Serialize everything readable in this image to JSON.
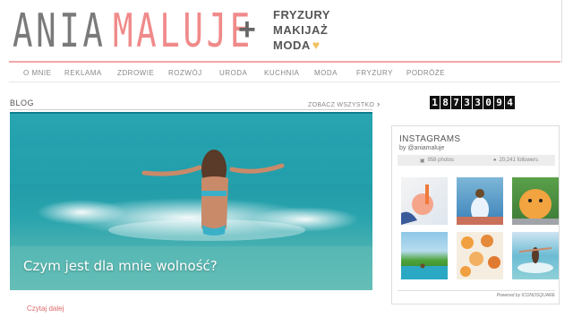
{
  "header": {
    "logo_part1": "ANIA",
    "logo_part2": "MALUJE",
    "plus": "+",
    "tagline": [
      "FRYZURY",
      "MAKIJAŻ",
      "MODA"
    ]
  },
  "nav": {
    "items": [
      "O MNIE",
      "REKLAMA",
      "ZDROWIE",
      "ROZWÓJ",
      "URODA",
      "KUCHNIA",
      "MODA",
      "FRYZURY",
      "PODRÓŻE"
    ]
  },
  "blog": {
    "label": "BLOG",
    "see_all": "ZOBACZ WSZYSTKO",
    "post_title": "Czym jest dla mnie wolność?",
    "read_more": "Czytaj dalej"
  },
  "counter": {
    "value": "18733094"
  },
  "instagram": {
    "title": "INSTAGRAMS",
    "user": "by @aniamaluje",
    "photos": "958 photos",
    "followers": "20,241 followers",
    "powered_by": "Powered by ICONOSQUARE"
  },
  "colors": {
    "accent_pink": "#f08a8a",
    "logo_gray": "#7a7a7a",
    "sea": "#1f9aa8"
  }
}
